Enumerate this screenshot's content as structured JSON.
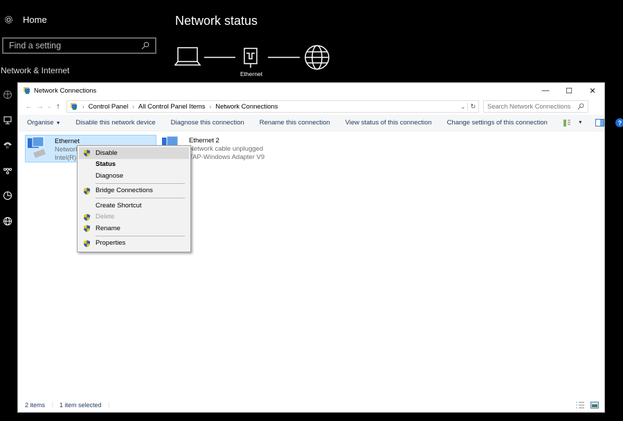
{
  "settings": {
    "home_label": "Home",
    "search_placeholder": "Find a setting",
    "section_label": "Network & Internet",
    "page_title": "Network status",
    "diagram_label": "Ethernet",
    "side_icons": [
      "data-usage-icon",
      "ethernet-icon",
      "dial-up-icon",
      "vpn-icon",
      "data-usage-pie-icon",
      "proxy-globe-icon"
    ]
  },
  "window": {
    "title": "Network Connections",
    "controls": {
      "minimize": "—",
      "maximize": "☐",
      "close": "✕"
    },
    "breadcrumb": [
      "Control Panel",
      "All Control Panel Items",
      "Network Connections"
    ],
    "search_placeholder": "Search Network Connections",
    "commands": {
      "organise": "Organise",
      "disable": "Disable this network device",
      "diagnose": "Diagnose this connection",
      "rename": "Rename this connection",
      "view_status": "View status of this connection",
      "change_settings": "Change settings of this connection"
    },
    "items": [
      {
        "name": "Ethernet",
        "status": "Network",
        "device": "Intel(R)",
        "selected": true
      },
      {
        "name": "Ethernet 2",
        "status": "Network cable unplugged",
        "device": "TAP-Windows Adapter V9",
        "selected": false
      }
    ],
    "status": {
      "count": "2 items",
      "selected": "1 item selected"
    }
  },
  "context_menu": {
    "items": [
      {
        "label": "Disable",
        "shield": true,
        "highlighted": true
      },
      {
        "label": "Status",
        "bold": true
      },
      {
        "label": "Diagnose"
      },
      {
        "label": "Bridge Connections",
        "shield": true
      },
      {
        "label": "Create Shortcut"
      },
      {
        "label": "Delete",
        "shield": true,
        "disabled": true
      },
      {
        "label": "Rename",
        "shield": true
      },
      {
        "label": "Properties",
        "shield": true
      }
    ]
  }
}
